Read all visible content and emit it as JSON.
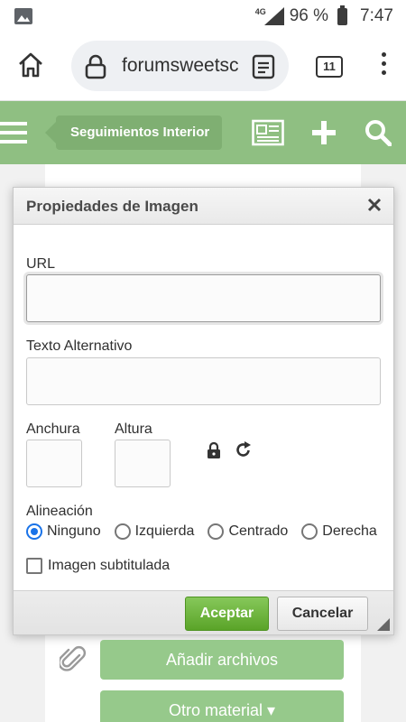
{
  "status_bar": {
    "network": "4G",
    "battery_percent": "96 %",
    "time": "7:47"
  },
  "browser": {
    "url": "forumsweetsc",
    "tab_count": "11"
  },
  "site_nav": {
    "forum_name": "Seguimientos Interior"
  },
  "dialog": {
    "title": "Propiedades de Imagen",
    "url_label": "URL",
    "url_value": "",
    "alt_label": "Texto Alternativo",
    "alt_value": "",
    "width_label": "Anchura",
    "width_value": "",
    "height_label": "Altura",
    "height_value": "",
    "alignment_label": "Alineación",
    "alignment_options": [
      "Ninguno",
      "Izquierda",
      "Centrado",
      "Derecha"
    ],
    "alignment_selected": "Ninguno",
    "caption_label": "Imagen subtitulada",
    "caption_checked": false,
    "ok_label": "Aceptar",
    "cancel_label": "Cancelar"
  },
  "page": {
    "add_files_label": "Añadir archivos",
    "other_material_label": "Otro material ▾"
  },
  "colors": {
    "nav_green": "#8fbf82",
    "button_green": "#96c98b",
    "ok_green": "#5aa428",
    "radio_blue": "#1a73e8"
  },
  "icons": [
    "image-icon",
    "signal-icon",
    "battery-icon",
    "home-icon",
    "lock-icon",
    "reader-mode-icon",
    "more-vert-icon",
    "hamburger-icon",
    "news-icon",
    "plus-icon",
    "search-icon",
    "close-icon",
    "aspect-lock-icon",
    "reset-size-icon",
    "resize-grip-icon",
    "paperclip-icon"
  ]
}
